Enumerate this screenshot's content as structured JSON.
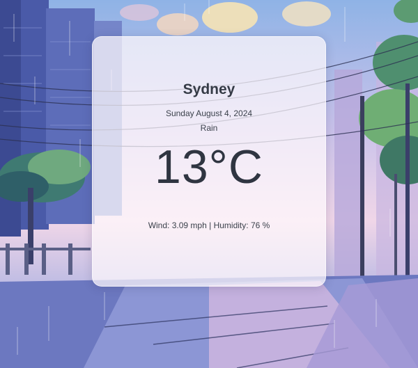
{
  "weather": {
    "city": "Sydney",
    "date": "Sunday August 4, 2024",
    "condition": "Rain",
    "temperature": "13°C",
    "wind_label": "Wind:",
    "wind_value": "3.09 mph",
    "separator": "|",
    "humidity_label": "Humidity:",
    "humidity_value": "76 %"
  },
  "background": {
    "icon": "rainy-city-street-illustration",
    "accent_colors": [
      "#8fb3e6",
      "#f0d6e8",
      "#5f6fb0"
    ]
  }
}
